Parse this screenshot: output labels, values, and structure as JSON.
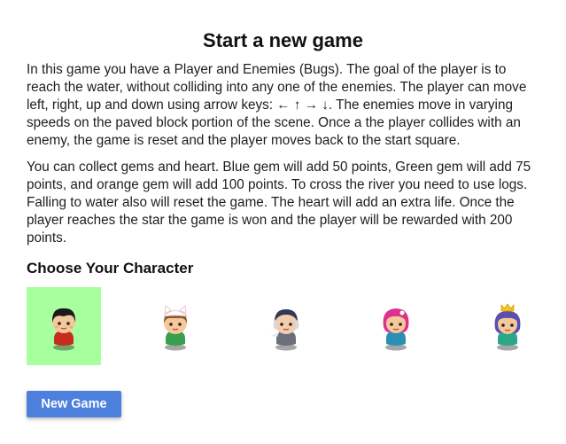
{
  "title": "Start a new game",
  "paragraphs": [
    "In this game you have a Player and Enemies (Bugs). The goal of the player is to reach the water, without colliding into any one of the enemies. The player can move left, right, up and down using arrow keys: ← ↑ → ↓. The enemies move in varying speeds on the paved block portion of the scene. Once a the player collides with an enemy, the game is reset and the player moves back to the start square.",
    "You can collect gems and heart. Blue gem will add 50 points, Green gem will add 75 points, and orange gem will add 100 points. To cross the river you need to use logs. Falling to water also will reset the game. The heart will add an extra life. Once the player reaches the star the game is won and the player will be rewarded with 200 points."
  ],
  "choose_heading": "Choose Your Character",
  "characters": [
    {
      "icon": "boy-character-icon",
      "selected": true
    },
    {
      "icon": "cat-girl-character-icon",
      "selected": false
    },
    {
      "icon": "horn-girl-character-icon",
      "selected": false
    },
    {
      "icon": "pink-girl-character-icon",
      "selected": false
    },
    {
      "icon": "princess-girl-character-icon",
      "selected": false
    }
  ],
  "colors": {
    "selected_highlight": "#a8ff9e",
    "button_background": "#4d7fdd",
    "button_text": "#ffffff"
  },
  "new_game_button": "New Game"
}
